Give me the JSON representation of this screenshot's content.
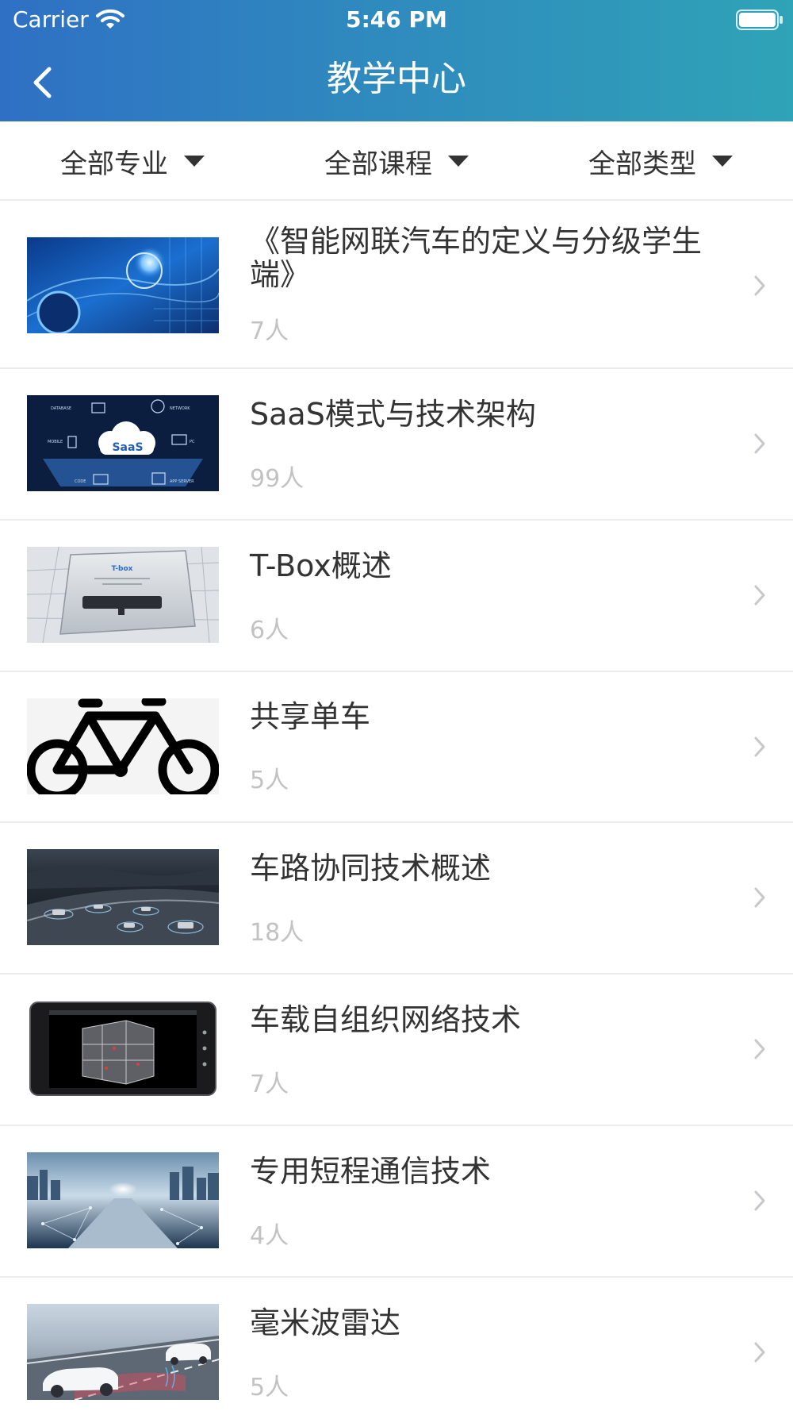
{
  "status_bar": {
    "carrier": "Carrier",
    "time": "5:46 PM"
  },
  "nav": {
    "title": "教学中心"
  },
  "filters": [
    {
      "label": "全部专业"
    },
    {
      "label": "全部课程"
    },
    {
      "label": "全部类型"
    }
  ],
  "courses": [
    {
      "title": "《智能网联汽车的定义与分级学生端》",
      "count": "7人",
      "thumbnail": "connected-car-headlight"
    },
    {
      "title": "SaaS模式与技术架构",
      "count": "99人",
      "thumbnail": "saas-cloud-diagram"
    },
    {
      "title": "T-Box概述",
      "count": "6人",
      "thumbnail": "t-box-device"
    },
    {
      "title": "共享单车",
      "count": "5人",
      "thumbnail": "bicycle"
    },
    {
      "title": "车路协同技术概述",
      "count": "18人",
      "thumbnail": "highway-vehicles-night"
    },
    {
      "title": "车载自组织网络技术",
      "count": "7人",
      "thumbnail": "tablet-building-3d"
    },
    {
      "title": "专用短程通信技术",
      "count": "4人",
      "thumbnail": "city-network-road"
    },
    {
      "title": "毫米波雷达",
      "count": "5人",
      "thumbnail": "radar-cars"
    }
  ],
  "colors": {
    "header_start": "#2f70c4",
    "header_end": "#2fa3b7",
    "count_text": "#c2c2c2",
    "chevron": "#c7c7cc"
  }
}
